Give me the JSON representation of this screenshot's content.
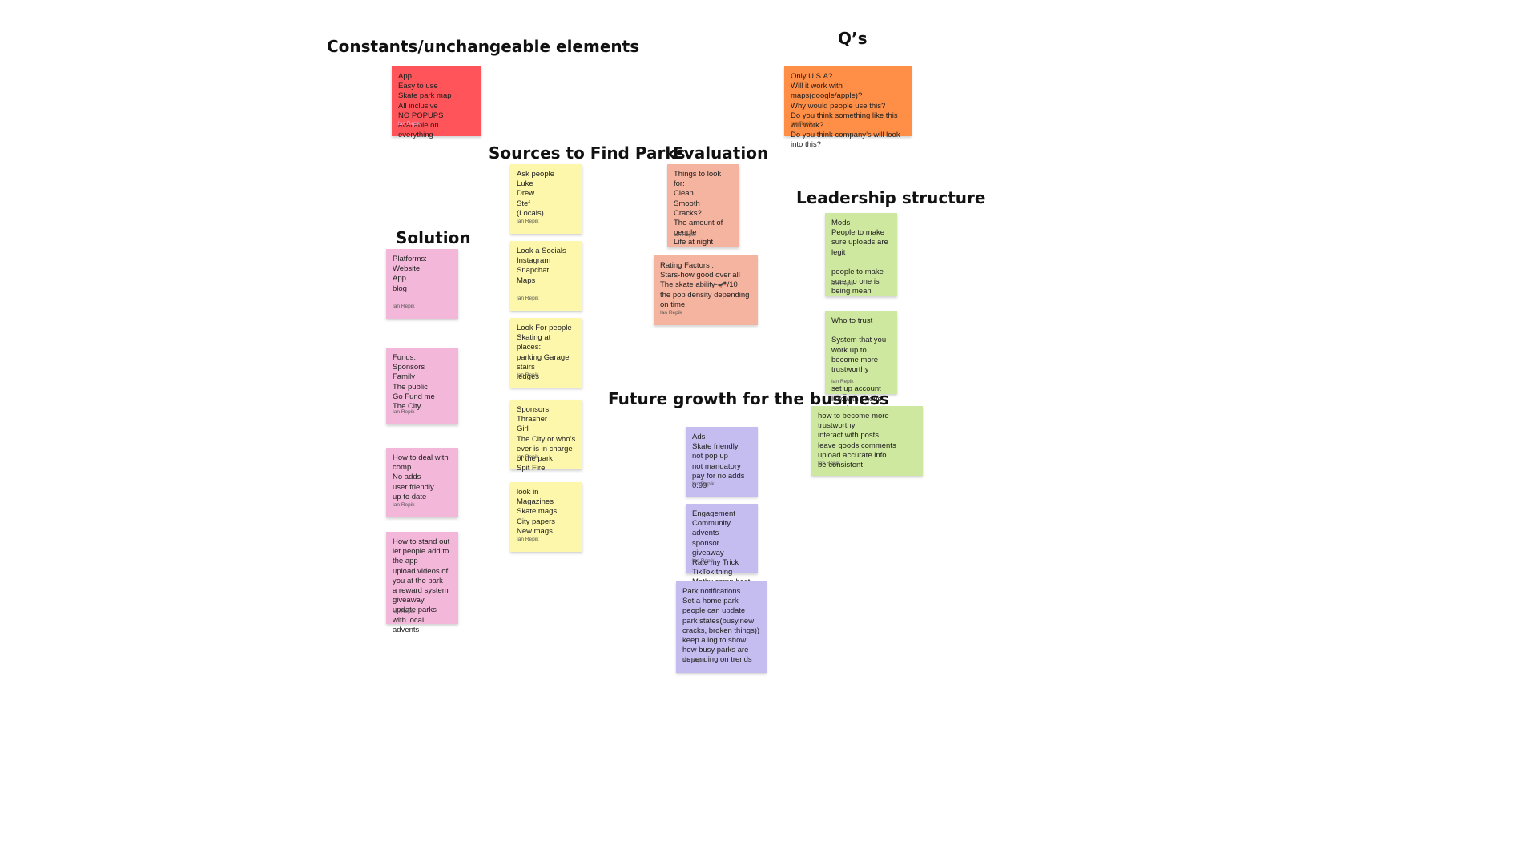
{
  "headings": {
    "constants": "Constants/unchangeable elements",
    "questions": "Q’s",
    "sources": "Sources to Find Parks",
    "evaluation": "Evaluation",
    "leadership": "Leadership structure",
    "solution": "Solution",
    "future": "Future growth for the business"
  },
  "author": "Ian Repik",
  "notes": {
    "constants": "App\nEasy to use\nSkate park map\nAll inclusive\nNO POPUPS\navailable on everything",
    "questions": "Only U.S.A?\nWill it work with maps(google/apple)?\nWhy would people use this?\nDo you think something like this will work?\nDo you think company’s will look into this?",
    "solution_platforms": "Platforms:\nWebsite\nApp\nblog",
    "solution_funds": "Funds:\nSponsors\nFamily\nThe public\nGo Fund me\nThe City",
    "solution_comp": "How to deal with comp\nNo adds\nuser friendly\nup to date",
    "solution_standout": "How to stand out\nlet people add to the app\nupload videos of you at the park\na reward system\ngiveaway\nupdate parks with local advents",
    "sources_ask": "Ask people\nLuke\nDrew\nStef\n(Locals)",
    "sources_socials": "Look a Socials\nInstagram\nSnapchat\nMaps",
    "sources_people": "Look For people\nSkating at places:\nparking Garage\nstairs\nledges",
    "sources_sponsors": "Sponsors:\nThrasher\nGirl\nThe City or who’s ever is in charge of the park\nSpit Fire",
    "sources_magazines": "look in Magazines\nSkate mags\nCity papers\nNew mags",
    "evaluation_things": "Things to look for:\nClean\nSmooth\nCracks?\nThe amount of people\nLife at night",
    "evaluation_rating": "Rating Factors :\nStars-how good over all\nThe skate ability-🛹/10\nthe pop density depending on time",
    "leadership_mods": "Mods\nPeople to make sure uploads are legit\n\npeople to make sure no one is being mean",
    "leadership_trust": "Who to trust\n\nSystem that you work up to become more trustworthy\n\nset up account link with phone number",
    "leadership_become": "how to become more trustworthy\ninteract with posts\nleave goods comments\nupload accurate info\nbe consistent",
    "future_ads": "Ads\nSkate friendly\nnot pop up\nnot mandatory\npay for no adds 0.99",
    "future_engagement": "Engagement\n Community advents\nsponsor giveaway\nRate my Trick TikTok thing\nMothy comp best clip",
    "future_notifications": "Park notifications\nSet a home park\npeople can update park states(busy,new cracks, broken things))\nkeep a log to show how busy parks are depending on trends"
  },
  "colors": {
    "red": "#ff5459",
    "orange": "#ff8e47",
    "pink": "#f2b7d9",
    "yellow": "#fdf7ab",
    "salmon": "#f5b4a0",
    "green": "#cfe8a0",
    "purple": "#c5bcef"
  }
}
